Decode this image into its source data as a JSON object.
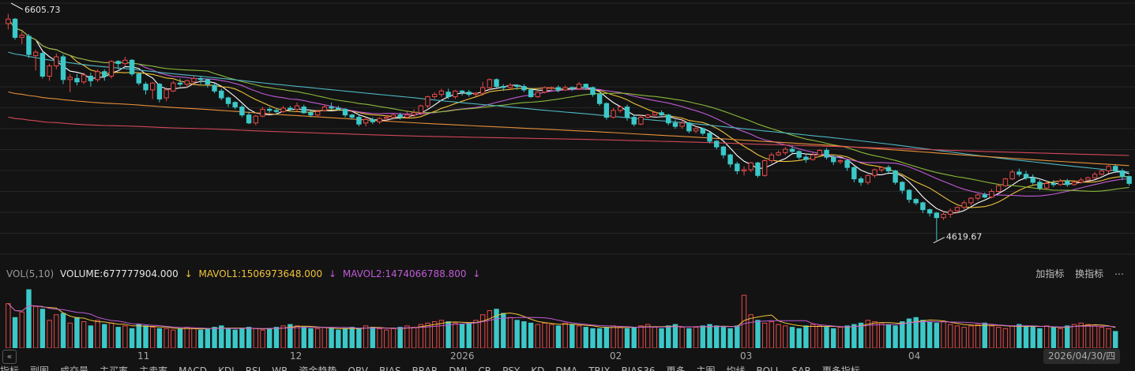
{
  "price_chart": {
    "high_label": "6605.73",
    "low_label": "4619.67"
  },
  "volume_header": {
    "indicator": "VOL(5,10)",
    "volume_text": "VOLUME:677777904.000",
    "mavol1_text": "MAVOL1:1506973648.000",
    "mavol2_text": "MAVOL2:1474066788.800",
    "arrow": "↓",
    "add_indicator": "加指标",
    "switch_indicator": "换指标",
    "mavol1_color": "#f0c23b",
    "mavol2_color": "#c05bd6"
  },
  "date_axis": {
    "ticks": [
      "11",
      "12",
      "2026",
      "02",
      "03",
      "04"
    ],
    "current_date": "2026/04/30/四"
  },
  "bottom_tabs": [
    "指标",
    "副图",
    "成交量",
    "主买率",
    "主卖率",
    "MACD",
    "KDJ",
    "RSI",
    "WR",
    "资金趋势",
    "OBV",
    "BIAS",
    "BRAR",
    "DMI",
    "CR",
    "PSY",
    "KD",
    "DMA",
    "TRIX",
    "BIAS36",
    "更多",
    "主图",
    "均线",
    "BOLL",
    "SAR",
    "更多指标"
  ],
  "colors": {
    "up": "#e84a4a",
    "down": "#3cc8c8",
    "ma5": "#ffffff",
    "ma10": "#f0c23b",
    "ma20": "#c05bd6",
    "ma30": "#8bb83a",
    "ma60": "#4fb7c4",
    "ma120": "#e8903a",
    "ma250": "#d2475a"
  },
  "chart_data": {
    "type": "candlestick",
    "y_range": [
      4500,
      6700
    ],
    "high": 6605.73,
    "low": 4619.67,
    "candles": [
      [
        6520,
        6560,
        6470,
        6605.73
      ],
      [
        6560,
        6400,
        6380,
        6570
      ],
      [
        6400,
        6420,
        6340,
        6460
      ],
      [
        6410,
        6250,
        6220,
        6430
      ],
      [
        6240,
        6270,
        6110,
        6290
      ],
      [
        6260,
        6060,
        6040,
        6280
      ],
      [
        6060,
        6150,
        6020,
        6170
      ],
      [
        6150,
        6230,
        6120,
        6260
      ],
      [
        6230,
        6030,
        5990,
        6250
      ],
      [
        6030,
        6050,
        5920,
        6080
      ],
      [
        6040,
        6010,
        5980,
        6080
      ],
      [
        6010,
        6070,
        5990,
        6090
      ],
      [
        6060,
        6020,
        5970,
        6090
      ],
      [
        6030,
        6100,
        6010,
        6120
      ],
      [
        6100,
        6060,
        6020,
        6120
      ],
      [
        6060,
        6190,
        6040,
        6200
      ],
      [
        6190,
        6170,
        6120,
        6200
      ],
      [
        6170,
        6200,
        6150,
        6230
      ],
      [
        6200,
        6080,
        6060,
        6210
      ],
      [
        6080,
        6000,
        5980,
        6090
      ],
      [
        5990,
        5940,
        5900,
        6010
      ],
      [
        5940,
        6000,
        5860,
        6010
      ],
      [
        5990,
        5860,
        5830,
        6000
      ],
      [
        5870,
        5940,
        5840,
        5960
      ],
      [
        5930,
        6000,
        5920,
        6020
      ],
      [
        6000,
        5990,
        5970,
        6040
      ],
      [
        5990,
        6020,
        5960,
        6030
      ],
      [
        6010,
        6040,
        5990,
        6060
      ],
      [
        6040,
        6030,
        5990,
        6060
      ],
      [
        6030,
        5990,
        5960,
        6040
      ],
      [
        5980,
        5930,
        5910,
        6000
      ],
      [
        5930,
        5870,
        5850,
        5950
      ],
      [
        5870,
        5820,
        5790,
        5880
      ],
      [
        5830,
        5790,
        5770,
        5840
      ],
      [
        5790,
        5720,
        5700,
        5810
      ],
      [
        5720,
        5650,
        5640,
        5750
      ],
      [
        5650,
        5710,
        5630,
        5720
      ],
      [
        5710,
        5770,
        5700,
        5790
      ],
      [
        5770,
        5760,
        5740,
        5790
      ],
      [
        5760,
        5750,
        5720,
        5780
      ],
      [
        5750,
        5780,
        5740,
        5800
      ],
      [
        5780,
        5770,
        5750,
        5800
      ],
      [
        5770,
        5800,
        5750,
        5830
      ],
      [
        5790,
        5740,
        5730,
        5810
      ],
      [
        5740,
        5720,
        5700,
        5760
      ],
      [
        5720,
        5750,
        5700,
        5770
      ],
      [
        5760,
        5790,
        5750,
        5810
      ],
      [
        5790,
        5780,
        5760,
        5830
      ],
      [
        5780,
        5770,
        5760,
        5800
      ],
      [
        5770,
        5720,
        5700,
        5780
      ],
      [
        5720,
        5700,
        5680,
        5730
      ],
      [
        5700,
        5640,
        5620,
        5720
      ],
      [
        5650,
        5680,
        5620,
        5700
      ],
      [
        5680,
        5660,
        5640,
        5700
      ],
      [
        5660,
        5690,
        5640,
        5700
      ],
      [
        5690,
        5700,
        5660,
        5720
      ],
      [
        5700,
        5720,
        5680,
        5730
      ],
      [
        5720,
        5700,
        5680,
        5740
      ],
      [
        5700,
        5720,
        5690,
        5760
      ],
      [
        5720,
        5740,
        5700,
        5770
      ],
      [
        5740,
        5800,
        5720,
        5810
      ],
      [
        5800,
        5880,
        5780,
        5890
      ],
      [
        5880,
        5900,
        5860,
        5920
      ],
      [
        5900,
        5930,
        5880,
        5950
      ],
      [
        5920,
        5880,
        5860,
        5950
      ],
      [
        5880,
        5930,
        5860,
        5940
      ],
      [
        5930,
        5920,
        5890,
        5940
      ],
      [
        5920,
        5900,
        5880,
        5940
      ],
      [
        5900,
        5910,
        5880,
        5920
      ],
      [
        5910,
        5960,
        5890,
        6010
      ],
      [
        5960,
        6030,
        5940,
        6040
      ],
      [
        6030,
        5970,
        5960,
        6040
      ],
      [
        5970,
        5960,
        5930,
        5990
      ],
      [
        5960,
        5980,
        5940,
        6000
      ],
      [
        5980,
        5970,
        5940,
        5990
      ],
      [
        5970,
        5940,
        5920,
        5990
      ],
      [
        5940,
        5880,
        5870,
        5960
      ],
      [
        5880,
        5920,
        5870,
        5930
      ],
      [
        5920,
        5960,
        5910,
        5970
      ],
      [
        5960,
        5960,
        5940,
        5970
      ],
      [
        5960,
        5940,
        5920,
        5980
      ],
      [
        5940,
        5960,
        5930,
        5980
      ],
      [
        5960,
        5950,
        5930,
        5970
      ],
      [
        5950,
        5990,
        5940,
        6010
      ],
      [
        5990,
        5960,
        5940,
        5990
      ],
      [
        5960,
        5900,
        5880,
        5970
      ],
      [
        5900,
        5820,
        5800,
        5910
      ],
      [
        5820,
        5700,
        5680,
        5830
      ],
      [
        5700,
        5760,
        5690,
        5780
      ],
      [
        5760,
        5790,
        5740,
        5800
      ],
      [
        5790,
        5700,
        5670,
        5810
      ],
      [
        5700,
        5640,
        5620,
        5720
      ],
      [
        5640,
        5700,
        5630,
        5720
      ],
      [
        5700,
        5720,
        5690,
        5730
      ],
      [
        5720,
        5740,
        5700,
        5750
      ],
      [
        5740,
        5720,
        5710,
        5760
      ],
      [
        5720,
        5650,
        5630,
        5730
      ],
      [
        5650,
        5620,
        5600,
        5680
      ],
      [
        5620,
        5650,
        5600,
        5690
      ],
      [
        5650,
        5580,
        5560,
        5660
      ],
      [
        5580,
        5600,
        5560,
        5620
      ],
      [
        5600,
        5560,
        5540,
        5610
      ],
      [
        5560,
        5490,
        5470,
        5570
      ],
      [
        5490,
        5440,
        5420,
        5500
      ],
      [
        5440,
        5370,
        5340,
        5450
      ],
      [
        5370,
        5290,
        5260,
        5380
      ],
      [
        5290,
        5230,
        5200,
        5310
      ],
      [
        5230,
        5240,
        5190,
        5270
      ],
      [
        5240,
        5300,
        5220,
        5310
      ],
      [
        5300,
        5190,
        5170,
        5310
      ],
      [
        5190,
        5320,
        5180,
        5330
      ],
      [
        5320,
        5370,
        5300,
        5390
      ],
      [
        5370,
        5390,
        5360,
        5410
      ],
      [
        5390,
        5420,
        5370,
        5440
      ],
      [
        5420,
        5400,
        5380,
        5450
      ],
      [
        5400,
        5350,
        5330,
        5410
      ],
      [
        5350,
        5330,
        5300,
        5370
      ],
      [
        5330,
        5370,
        5320,
        5390
      ],
      [
        5370,
        5410,
        5360,
        5420
      ],
      [
        5410,
        5350,
        5330,
        5430
      ],
      [
        5350,
        5310,
        5280,
        5370
      ],
      [
        5310,
        5320,
        5290,
        5330
      ],
      [
        5320,
        5260,
        5230,
        5330
      ],
      [
        5260,
        5160,
        5130,
        5270
      ],
      [
        5160,
        5130,
        5100,
        5180
      ],
      [
        5130,
        5190,
        5110,
        5200
      ],
      [
        5190,
        5240,
        5170,
        5250
      ],
      [
        5240,
        5260,
        5220,
        5270
      ],
      [
        5260,
        5230,
        5200,
        5280
      ],
      [
        5230,
        5130,
        5110,
        5240
      ],
      [
        5130,
        5060,
        5030,
        5140
      ],
      [
        5060,
        4980,
        4950,
        5070
      ],
      [
        4980,
        4950,
        4930,
        4990
      ],
      [
        4950,
        4890,
        4860,
        4960
      ],
      [
        4890,
        4860,
        4830,
        4900
      ],
      [
        4860,
        4820,
        4619.67,
        4870
      ],
      [
        4820,
        4850,
        4800,
        4880
      ],
      [
        4850,
        4880,
        4820,
        4900
      ],
      [
        4880,
        4910,
        4860,
        4920
      ],
      [
        4910,
        4950,
        4890,
        4970
      ],
      [
        4950,
        4990,
        4930,
        5000
      ],
      [
        4990,
        5020,
        4970,
        5030
      ],
      [
        5020,
        5000,
        4990,
        5040
      ],
      [
        5000,
        5050,
        4990,
        5070
      ],
      [
        5050,
        5100,
        5040,
        5110
      ],
      [
        5100,
        5160,
        5090,
        5170
      ],
      [
        5160,
        5220,
        5150,
        5240
      ],
      [
        5220,
        5200,
        5180,
        5250
      ],
      [
        5200,
        5170,
        5150,
        5230
      ],
      [
        5170,
        5130,
        5110,
        5200
      ],
      [
        5130,
        5080,
        5060,
        5150
      ],
      [
        5080,
        5120,
        5070,
        5140
      ],
      [
        5120,
        5110,
        5090,
        5150
      ],
      [
        5110,
        5140,
        5100,
        5160
      ],
      [
        5140,
        5110,
        5090,
        5160
      ],
      [
        5110,
        5130,
        5100,
        5150
      ],
      [
        5130,
        5150,
        5120,
        5170
      ],
      [
        5150,
        5170,
        5140,
        5180
      ],
      [
        5170,
        5200,
        5160,
        5220
      ],
      [
        5200,
        5230,
        5190,
        5240
      ],
      [
        5230,
        5270,
        5210,
        5280
      ],
      [
        5270,
        5230,
        5210,
        5290
      ],
      [
        5230,
        5180,
        5150,
        5250
      ],
      [
        5180,
        5120,
        5100,
        5190
      ]
    ],
    "volumes": [
      1.6,
      1.1,
      1.3,
      2.1,
      1.5,
      1.4,
      1.0,
      1.2,
      1.25,
      0.9,
      1.1,
      0.95,
      0.8,
      1.0,
      0.85,
      0.9,
      0.75,
      0.8,
      0.7,
      0.85,
      0.8,
      0.75,
      0.7,
      0.7,
      0.65,
      0.7,
      0.75,
      0.7,
      0.65,
      0.7,
      0.75,
      0.8,
      0.7,
      0.65,
      0.7,
      0.75,
      0.7,
      0.65,
      0.7,
      0.75,
      0.8,
      0.85,
      0.8,
      0.75,
      0.7,
      0.7,
      0.75,
      0.7,
      0.65,
      0.7,
      0.75,
      0.7,
      0.8,
      0.75,
      0.7,
      0.65,
      0.7,
      0.75,
      0.8,
      0.75,
      0.85,
      0.9,
      0.95,
      1.0,
      0.95,
      0.9,
      0.85,
      0.9,
      1.0,
      1.2,
      1.35,
      1.4,
      1.25,
      1.1,
      1.0,
      0.95,
      0.9,
      0.85,
      0.9,
      0.85,
      0.8,
      0.9,
      0.85,
      0.8,
      0.75,
      0.7,
      0.7,
      0.75,
      0.8,
      0.75,
      0.7,
      0.75,
      0.8,
      0.85,
      0.75,
      0.7,
      0.8,
      0.85,
      0.75,
      0.7,
      0.75,
      0.8,
      0.85,
      0.8,
      0.75,
      0.7,
      0.8,
      1.9,
      1.2,
      1.0,
      0.9,
      0.95,
      0.85,
      0.8,
      0.75,
      0.7,
      0.8,
      0.85,
      0.8,
      0.75,
      0.7,
      0.75,
      0.8,
      0.85,
      0.9,
      1.0,
      0.95,
      0.9,
      0.85,
      0.8,
      0.95,
      1.05,
      1.1,
      1.0,
      0.95,
      0.9,
      0.95,
      0.85,
      0.8,
      0.75,
      0.8,
      0.85,
      0.9,
      0.8,
      0.75,
      0.7,
      0.8,
      0.85,
      0.8,
      0.75,
      0.7,
      0.8,
      0.75,
      0.7,
      0.8,
      0.85,
      0.9,
      0.85,
      0.8,
      0.75,
      0.7,
      0.6
    ],
    "volume_range": [
      0,
      2.3
    ],
    "ma_periods": [
      5,
      10,
      20,
      30,
      60,
      120,
      250
    ]
  }
}
